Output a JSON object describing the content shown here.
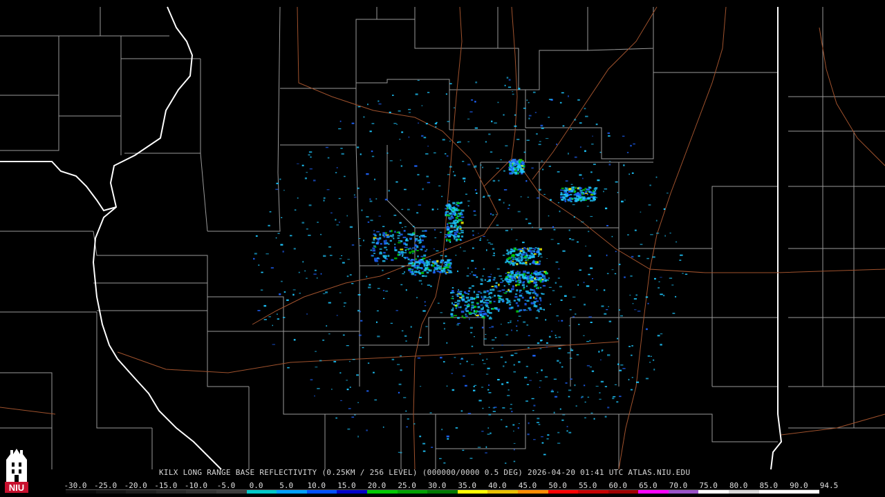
{
  "header": {
    "caption": "KILX LONG RANGE BASE REFLECTIVITY (0.25KM / 256 LEVEL) (000000/0000 0.5 DEG) 2026-04-20 01:41 UTC  ATLAS.NIU.EDU"
  },
  "logo": {
    "text": "NIU",
    "icon": "niu-tower-logo-icon"
  },
  "scale": {
    "labels": [
      "-30.0",
      "-25.0",
      "-20.0",
      "-15.0",
      "-10.0",
      "-5.0",
      "0.0",
      "5.0",
      "10.0",
      "15.0",
      "20.0",
      "25.0",
      "30.0",
      "35.0",
      "40.0",
      "45.0",
      "50.0",
      "55.0",
      "60.0",
      "65.0",
      "70.0",
      "75.0",
      "80.0",
      "85.0",
      "90.0",
      "94.5"
    ],
    "colors": [
      "#0a0a0a",
      "#141414",
      "#1e1e1e",
      "#282828",
      "#323232",
      "#3c3c3c",
      "#00c8c8",
      "#00a0ff",
      "#0050ff",
      "#0000c8",
      "#00c800",
      "#00a000",
      "#007800",
      "#ffff00",
      "#e8c000",
      "#ff8c00",
      "#ff0000",
      "#c80000",
      "#a00000",
      "#ff00ff",
      "#9a52c8",
      "#ffffff",
      "#d8d8d8",
      "#ffffff",
      "#ffffff"
    ]
  },
  "map_colors": {
    "county_lines": "#9a9a9a",
    "state_lines": "#ffffff",
    "highways": "#a0522d",
    "echo_light": "#1ec8ff",
    "echo_mid": "#1e64ff",
    "echo_heavy": "#00d200",
    "echo_peak": "#ffff00"
  }
}
